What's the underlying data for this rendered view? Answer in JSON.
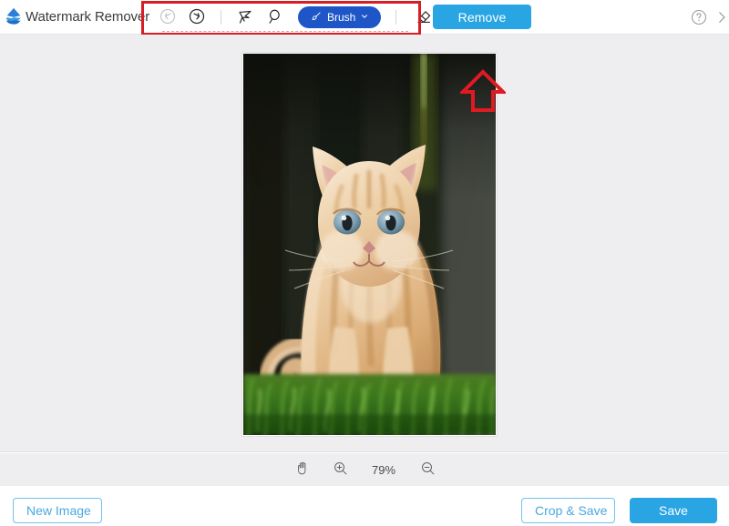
{
  "app": {
    "title": "Watermark Remover",
    "logo_icon": "water-wave-logo"
  },
  "toolbar": {
    "undo": {
      "label": "Undo",
      "icon": "undo-arrow-icon",
      "disabled": true
    },
    "redo": {
      "label": "Redo",
      "icon": "redo-arrow-icon",
      "disabled": false
    },
    "polygon_lasso": {
      "label": "Polygonal Lasso",
      "icon": "polygonal-lasso-icon"
    },
    "free_lasso": {
      "label": "Lasso",
      "icon": "lasso-icon"
    },
    "brush": {
      "label": "Brush",
      "icon": "brush-icon",
      "chevron": "chevron-down-icon",
      "active": true,
      "color": "#1e56c8"
    },
    "eraser": {
      "label": "Eraser",
      "icon": "eraser-icon"
    },
    "remove": {
      "label": "Remove",
      "color": "#29a5e3"
    },
    "help": {
      "label": "Help",
      "icon": "question-circle-icon"
    },
    "collapse": {
      "label": "Collapse",
      "icon": "chevron-right-icon"
    }
  },
  "canvas": {
    "image_alt": "Orange tabby kitten sitting in green grass against a dark wooden background",
    "background_color": "#eeeef0"
  },
  "annotations": {
    "highlight_box_color": "#d81e25",
    "arrow_icon": "up-arrow-annotation",
    "arrow_color": "#d81e25"
  },
  "zoombar": {
    "hand_tool": {
      "label": "Pan",
      "icon": "hand-icon"
    },
    "zoom_in": {
      "label": "Zoom In",
      "icon": "zoom-in-icon"
    },
    "zoom_level": "79%",
    "zoom_out": {
      "label": "Zoom Out",
      "icon": "zoom-out-icon"
    }
  },
  "bottombar": {
    "new_image": "New Image",
    "crop_save": "Crop & Save",
    "save": "Save"
  }
}
